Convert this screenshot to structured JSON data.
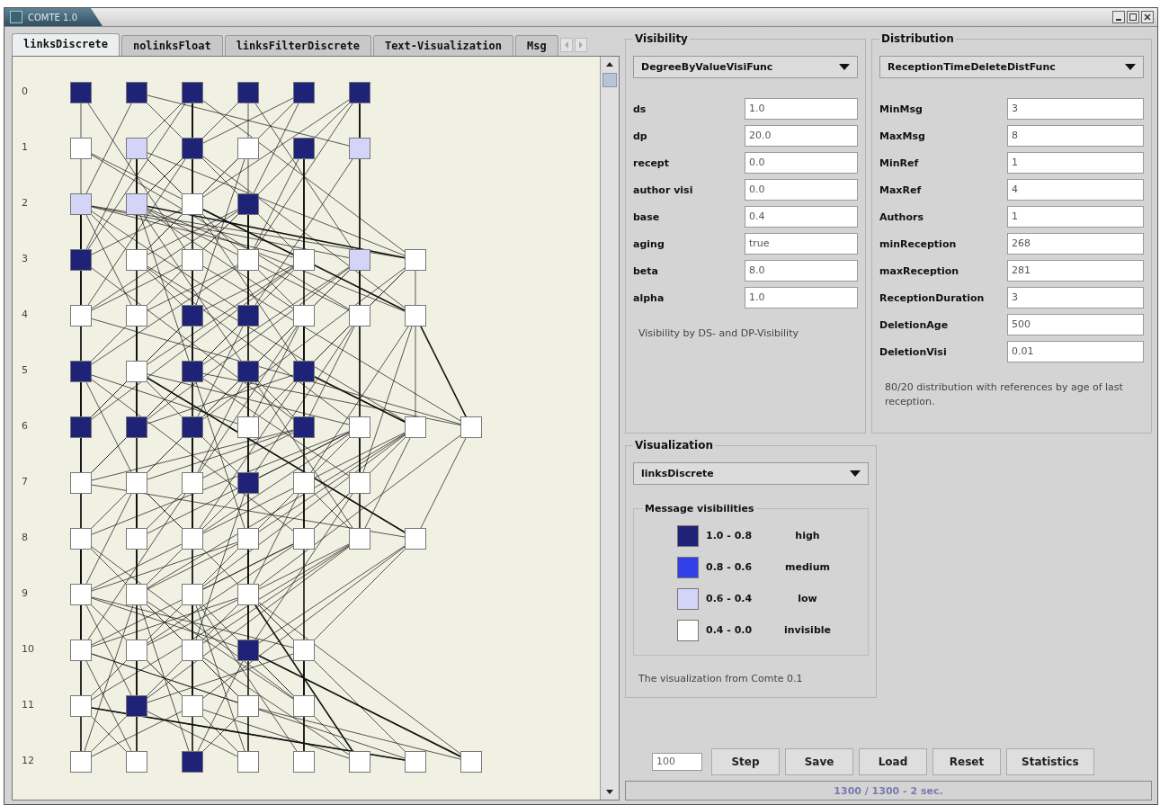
{
  "window": {
    "title": "COMTE 1.0"
  },
  "tabs": [
    {
      "label": "linksDiscrete",
      "selected": true
    },
    {
      "label": "nolinksFloat",
      "selected": false
    },
    {
      "label": "linksFilterDiscrete",
      "selected": false
    },
    {
      "label": "Text-Visualization",
      "selected": false
    },
    {
      "label": "Msg",
      "selected": false
    }
  ],
  "graph": {
    "rows": [
      {
        "label": "0",
        "nodes": [
          {
            "color": "#1f2377"
          },
          {
            "color": "#1f2377"
          },
          {
            "color": "#1f2377"
          },
          {
            "color": "#1f2377"
          },
          {
            "color": "#1f2377"
          },
          {
            "color": "#1f2377"
          }
        ]
      },
      {
        "label": "1",
        "nodes": [
          {
            "color": "#ffffff"
          },
          {
            "color": "#d4d4f8"
          },
          {
            "color": "#1f2377"
          },
          {
            "color": "#ffffff"
          },
          {
            "color": "#1f2377"
          },
          {
            "color": "#d4d4f8"
          }
        ]
      },
      {
        "label": "2",
        "nodes": [
          {
            "color": "#d4d4f8"
          },
          {
            "color": "#d4d4f8"
          },
          {
            "color": "#ffffff"
          },
          {
            "color": "#1f2377"
          }
        ]
      },
      {
        "label": "3",
        "nodes": [
          {
            "color": "#1f2377"
          },
          {
            "color": "#ffffff"
          },
          {
            "color": "#ffffff"
          },
          {
            "color": "#ffffff"
          },
          {
            "color": "#ffffff"
          },
          {
            "color": "#d4d4f8"
          },
          {
            "color": "#ffffff"
          }
        ]
      },
      {
        "label": "4",
        "nodes": [
          {
            "color": "#ffffff"
          },
          {
            "color": "#ffffff"
          },
          {
            "color": "#1f2377"
          },
          {
            "color": "#1f2377"
          },
          {
            "color": "#ffffff"
          },
          {
            "color": "#ffffff"
          },
          {
            "color": "#ffffff"
          }
        ]
      },
      {
        "label": "5",
        "nodes": [
          {
            "color": "#1f2377"
          },
          {
            "color": "#ffffff"
          },
          {
            "color": "#1f2377"
          },
          {
            "color": "#1f2377"
          },
          {
            "color": "#1f2377"
          }
        ]
      },
      {
        "label": "6",
        "nodes": [
          {
            "color": "#1f2377"
          },
          {
            "color": "#1f2377"
          },
          {
            "color": "#1f2377"
          },
          {
            "color": "#ffffff"
          },
          {
            "color": "#1f2377"
          },
          {
            "color": "#ffffff"
          },
          {
            "color": "#ffffff"
          },
          {
            "color": "#ffffff"
          }
        ]
      },
      {
        "label": "7",
        "nodes": [
          {
            "color": "#ffffff"
          },
          {
            "color": "#ffffff"
          },
          {
            "color": "#ffffff"
          },
          {
            "color": "#1f2377"
          },
          {
            "color": "#ffffff"
          },
          {
            "color": "#ffffff"
          }
        ]
      },
      {
        "label": "8",
        "nodes": [
          {
            "color": "#ffffff"
          },
          {
            "color": "#ffffff"
          },
          {
            "color": "#ffffff"
          },
          {
            "color": "#ffffff"
          },
          {
            "color": "#ffffff"
          },
          {
            "color": "#ffffff"
          },
          {
            "color": "#ffffff"
          }
        ]
      },
      {
        "label": "9",
        "nodes": [
          {
            "color": "#ffffff"
          },
          {
            "color": "#ffffff"
          },
          {
            "color": "#ffffff"
          },
          {
            "color": "#ffffff"
          }
        ]
      },
      {
        "label": "10",
        "nodes": [
          {
            "color": "#ffffff"
          },
          {
            "color": "#ffffff"
          },
          {
            "color": "#ffffff"
          },
          {
            "color": "#1f2377"
          },
          {
            "color": "#ffffff"
          }
        ]
      },
      {
        "label": "11",
        "nodes": [
          {
            "color": "#ffffff"
          },
          {
            "color": "#1f2377"
          },
          {
            "color": "#ffffff"
          },
          {
            "color": "#ffffff"
          },
          {
            "color": "#ffffff"
          }
        ]
      },
      {
        "label": "12",
        "nodes": [
          {
            "color": "#ffffff"
          },
          {
            "color": "#ffffff"
          },
          {
            "color": "#1f2377"
          },
          {
            "color": "#ffffff"
          },
          {
            "color": "#ffffff"
          },
          {
            "color": "#ffffff"
          },
          {
            "color": "#ffffff"
          },
          {
            "color": "#ffffff"
          }
        ]
      }
    ]
  },
  "visibility": {
    "title": "Visibility",
    "function": "DegreeByValueVisiFunc",
    "params": [
      {
        "label": "ds",
        "value": "1.0"
      },
      {
        "label": "dp",
        "value": "20.0"
      },
      {
        "label": "recept",
        "value": "0.0"
      },
      {
        "label": "author visi",
        "value": "0.0"
      },
      {
        "label": "base",
        "value": "0.4"
      },
      {
        "label": "aging",
        "value": "true"
      },
      {
        "label": "beta",
        "value": "8.0"
      },
      {
        "label": "alpha",
        "value": "1.0"
      }
    ],
    "description": "Visibility by DS- and DP-Visibility"
  },
  "distribution": {
    "title": "Distribution",
    "function": "ReceptionTimeDeleteDistFunc",
    "params": [
      {
        "label": "MinMsg",
        "value": "3"
      },
      {
        "label": "MaxMsg",
        "value": "8"
      },
      {
        "label": "MinRef",
        "value": "1"
      },
      {
        "label": "MaxRef",
        "value": "4"
      },
      {
        "label": "Authors",
        "value": "1"
      },
      {
        "label": "minReception",
        "value": "268"
      },
      {
        "label": "maxReception",
        "value": "281"
      },
      {
        "label": "ReceptionDuration",
        "value": "3"
      },
      {
        "label": "DeletionAge",
        "value": "500"
      },
      {
        "label": "DeletionVisi",
        "value": "0.01"
      }
    ],
    "description": "80/20 distribution with references by age of last reception."
  },
  "visualization": {
    "title": "Visualization",
    "function": "linksDiscrete",
    "legend": {
      "title": "Message visibilities",
      "items": [
        {
          "range": "1.0 - 0.8",
          "label": "high",
          "color": "#1f2377"
        },
        {
          "range": "0.8 - 0.6",
          "label": "medium",
          "color": "#3340e8"
        },
        {
          "range": "0.6 - 0.4",
          "label": "low",
          "color": "#d4d4f8"
        },
        {
          "range": "0.4 - 0.0",
          "label": "invisible",
          "color": "#ffffff"
        }
      ]
    },
    "description": "The visualization from Comte 0.1"
  },
  "controls": {
    "steps": "100",
    "buttons": [
      "Step",
      "Save",
      "Load",
      "Reset",
      "Statistics"
    ]
  },
  "status_bar": "1300 / 1300 - 2 sec."
}
